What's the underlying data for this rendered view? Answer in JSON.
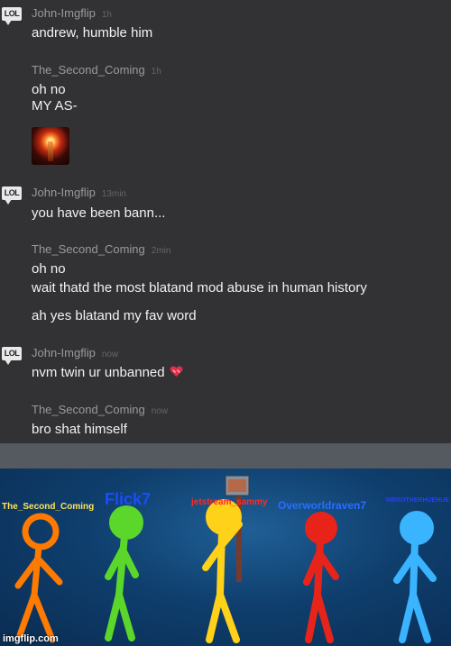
{
  "messages": [
    {
      "user": "John-Imgflip",
      "time": "1h",
      "lines": [
        "andrew, humble him"
      ]
    },
    {
      "user": "The_Second_Coming",
      "time": "1h",
      "lines": [
        "oh no",
        "MY AS-"
      ]
    },
    {
      "user": "John-Imgflip",
      "time": "13min",
      "lines": [
        "you have been bann..."
      ]
    },
    {
      "user": "The_Second_Coming",
      "time": "2min",
      "lines": [
        "oh no",
        "wait thatd the most blatand mod abuse in human history",
        "ah yes blatand my fav word"
      ]
    },
    {
      "user": "John-Imgflip",
      "time": "now",
      "lines": [
        "nvm twin ur unbanned"
      ]
    },
    {
      "user": "The_Second_Coming",
      "time": "now",
      "lines": [
        "bro shat himself"
      ]
    }
  ],
  "avatar_label": "LOL",
  "meme": {
    "names": [
      "The_Second_Coming",
      "Flick7",
      "jetstream_sammy",
      "Overworldraven7",
      "MBROTHERHUEHUE"
    ],
    "colors": [
      "#ff7a00",
      "#5bd62a",
      "#ffd21a",
      "#e8241a",
      "#3ab4ff"
    ],
    "name_colors": [
      "#ffe25a",
      "#1a4cff",
      "#ff2a2a",
      "#2a6cff",
      "#2a3cff"
    ]
  },
  "watermark": "imgflip.com"
}
